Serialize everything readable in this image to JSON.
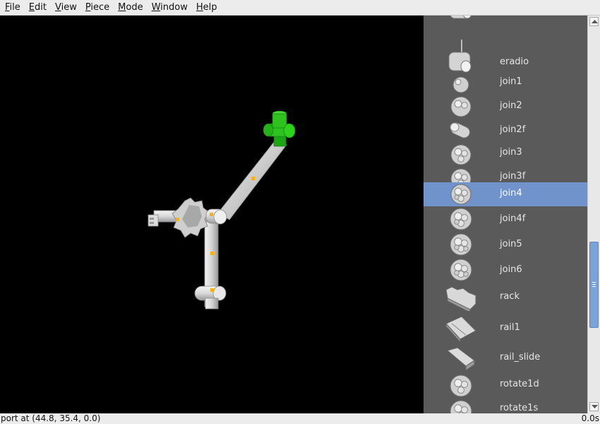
{
  "menubar": {
    "items": [
      {
        "key": "F",
        "rest": "ile"
      },
      {
        "key": "E",
        "rest": "dit"
      },
      {
        "key": "V",
        "rest": "iew"
      },
      {
        "key": "P",
        "rest": "iece"
      },
      {
        "key": "M",
        "rest": "ode"
      },
      {
        "key": "W",
        "rest": "indow"
      },
      {
        "key": "H",
        "rest": "elp"
      }
    ]
  },
  "palette": {
    "selected": "join4",
    "items": [
      {
        "label": "",
        "icon": "partial-piece-icon"
      },
      {
        "label": "eradio",
        "icon": "eradio-icon"
      },
      {
        "label": "join1",
        "icon": "join1-icon"
      },
      {
        "label": "join2",
        "icon": "join2-icon"
      },
      {
        "label": "join2f",
        "icon": "join2f-icon"
      },
      {
        "label": "join3",
        "icon": "join3-icon"
      },
      {
        "label": "join3f",
        "icon": "join3f-icon"
      },
      {
        "label": "join4",
        "icon": "join4-icon"
      },
      {
        "label": "join4f",
        "icon": "join4f-icon"
      },
      {
        "label": "join5",
        "icon": "join5-icon"
      },
      {
        "label": "join6",
        "icon": "join6-icon"
      },
      {
        "label": "rack",
        "icon": "rack-icon"
      },
      {
        "label": "rail1",
        "icon": "rail1-icon"
      },
      {
        "label": "rail_slide",
        "icon": "rail-slide-icon"
      },
      {
        "label": "rotate1d",
        "icon": "rotate1d-icon"
      },
      {
        "label": "rotate1s",
        "icon": "rotate1s-icon"
      }
    ]
  },
  "status": {
    "left": "port at (44.8, 35.4, 0.0)",
    "right": "0.0s"
  },
  "colors": {
    "viewport_bg": "#000000",
    "palette_bg": "#5a5a5a",
    "selection": "#7093cc",
    "highlight_piece": "#2fc21f",
    "port_marker": "#ffb000"
  }
}
